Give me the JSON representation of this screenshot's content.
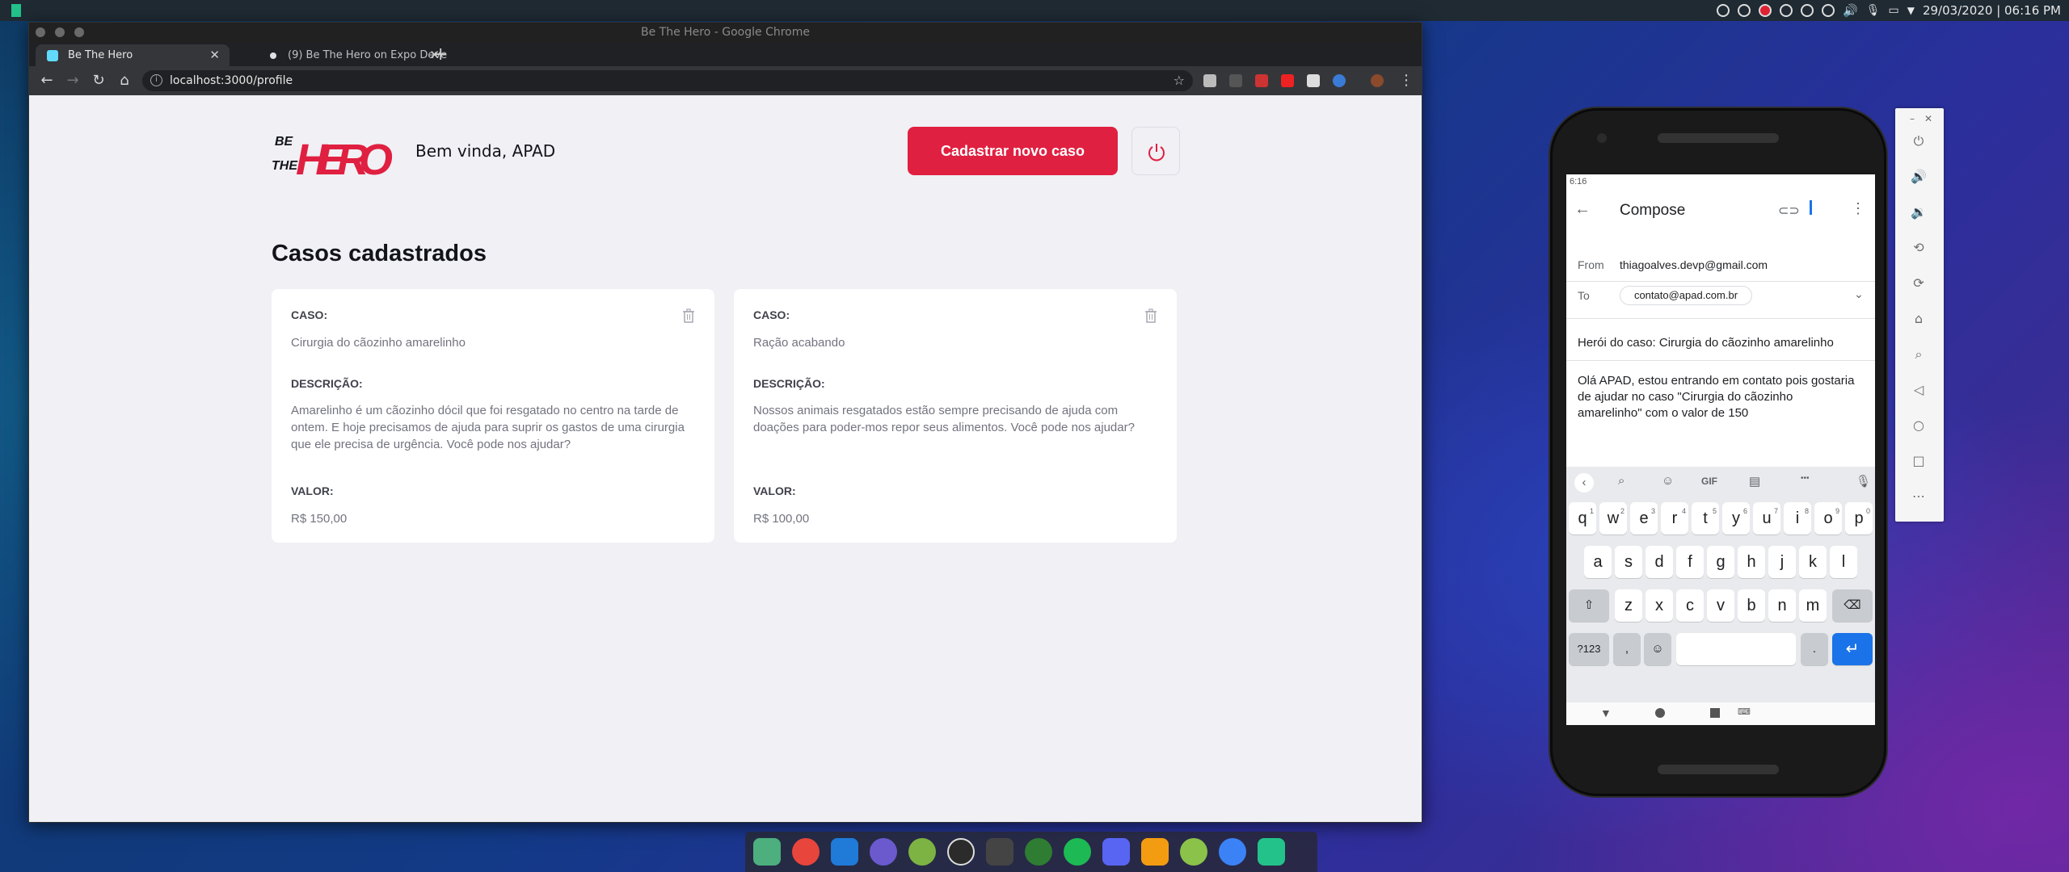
{
  "desktop": {
    "clock": "29/03/2020 | 06:16 PM"
  },
  "chrome": {
    "window_title": "Be The Hero - Google Chrome",
    "tabs": [
      {
        "label": "Be The Hero"
      },
      {
        "label": "(9) Be The Hero on Expo Deve"
      }
    ],
    "url": "localhost:3000/profile"
  },
  "profile": {
    "logo_text": "BE THE HERO",
    "greeting": "Bem vinda, APAD",
    "new_case_label": "Cadastrar novo caso",
    "section_title": "Casos cadastrados",
    "labels": {
      "case": "CASO:",
      "description": "DESCRIÇÃO:",
      "value": "VALOR:"
    },
    "cases": [
      {
        "title": "Cirurgia do cãozinho amarelinho",
        "description": "Amarelinho é um cãozinho dócil que foi resgatado no centro na tarde de ontem. E hoje precisamos de ajuda para suprir os gastos de uma cirurgia que ele precisa de urgência. Você pode nos ajudar?",
        "value": "R$ 150,00"
      },
      {
        "title": "Ração acabando",
        "description": "Nossos animais resgatados estão sempre precisando de ajuda com doações para poder-mos repor seus alimentos. Você pode nos ajudar?",
        "value": "R$ 100,00"
      }
    ]
  },
  "phone": {
    "time": "6:16",
    "compose_title": "Compose",
    "from_label": "From",
    "from_value": "thiagoalves.devp@gmail.com",
    "to_label": "To",
    "to_value": "contato@apad.com.br",
    "subject": "Herói do caso: Cirurgia do cãozinho amarelinho",
    "body": "Olá APAD, estou entrando em contato pois gostaria de ajudar no caso \"Cirurgia do cãozinho amarelinho\" com o valor de 150",
    "keyboard": {
      "gif": "GIF",
      "dots": "•••",
      "row1": [
        "q",
        "w",
        "e",
        "r",
        "t",
        "y",
        "u",
        "i",
        "o",
        "p"
      ],
      "row1_sup": [
        "1",
        "2",
        "3",
        "4",
        "5",
        "6",
        "7",
        "8",
        "9",
        "0"
      ],
      "row2": [
        "a",
        "s",
        "d",
        "f",
        "g",
        "h",
        "j",
        "k",
        "l"
      ],
      "row3": [
        "z",
        "x",
        "c",
        "v",
        "b",
        "n",
        "m"
      ],
      "sym": "?123",
      "comma": ",",
      "period": "."
    }
  },
  "colors": {
    "brand_red": "#e02041",
    "page_bg": "#f0f0f5",
    "enter_blue": "#1a73e8"
  }
}
